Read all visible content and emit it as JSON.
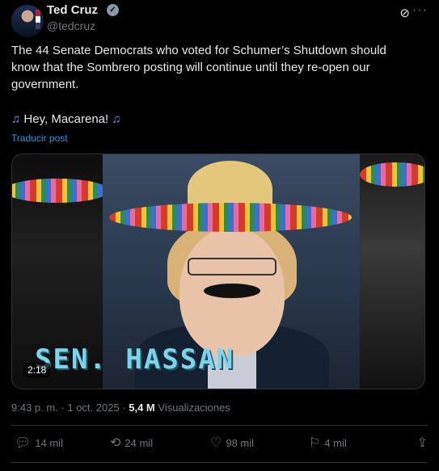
{
  "author": {
    "name": "Ted Cruz",
    "handle": "@tedcruz"
  },
  "post": {
    "text": "The 44 Senate Democrats who voted for Schumer’s Shutdown should know that the Sombrero posting will continue until they re-open our government.",
    "line2_text": "Hey, Macarena!",
    "translate_label": "Traducir post"
  },
  "media": {
    "caption": "SEN. HASSAN",
    "duration": "2:18"
  },
  "meta": {
    "time": "9:43 p. m. · 1 oct. 2025 · ",
    "views_count": "5,4 M",
    "views_label": " Visualizaciones"
  },
  "actions": {
    "replies": "14 mil",
    "reposts": "24 mil",
    "likes": "98 mil",
    "bookmarks": "4 mil"
  },
  "icons": [
    "verified-icon",
    "grok-icon",
    "more-icon",
    "music-note-icon",
    "reply-icon",
    "repost-icon",
    "like-icon",
    "bookmark-icon",
    "share-icon"
  ],
  "colors": {
    "background": "#000000",
    "link": "#1d9bf0",
    "muted": "#71767b",
    "text": "#e7e9ea"
  }
}
